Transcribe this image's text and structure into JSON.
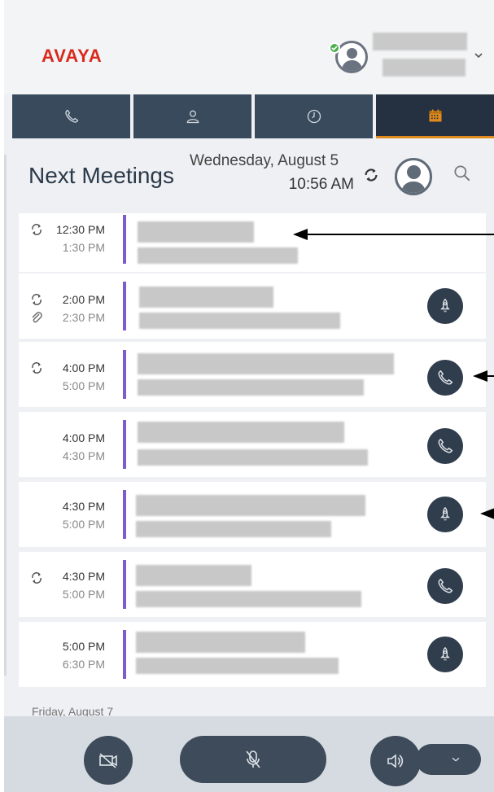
{
  "header": {
    "logo": "AVAYA",
    "icons": {
      "presence": "available-check-icon",
      "avatar": "user-avatar-icon",
      "menu": "chevron-down-icon"
    }
  },
  "tabs": [
    {
      "name": "calls",
      "icon": "phone-icon",
      "active": false
    },
    {
      "name": "contacts",
      "icon": "person-icon",
      "active": false
    },
    {
      "name": "history",
      "icon": "clock-icon",
      "active": false
    },
    {
      "name": "calendar",
      "icon": "calendar-icon",
      "active": true
    }
  ],
  "main": {
    "title": "Next Meetings",
    "date": "Wednesday, August 5",
    "time": "10:56 AM"
  },
  "meetings": [
    {
      "start": "12:30 PM",
      "end": "1:30 PM",
      "recurring": true,
      "attachment": false,
      "action": "none"
    },
    {
      "start": "2:00 PM",
      "end": "2:30 PM",
      "recurring": true,
      "attachment": true,
      "action": "rocket-icon"
    },
    {
      "start": "4:00 PM",
      "end": "5:00 PM",
      "recurring": true,
      "attachment": false,
      "action": "phone-icon"
    },
    {
      "start": "4:00 PM",
      "end": "4:30 PM",
      "recurring": false,
      "attachment": false,
      "action": "phone-icon"
    },
    {
      "start": "4:30 PM",
      "end": "5:00 PM",
      "recurring": false,
      "attachment": false,
      "action": "rocket-icon"
    },
    {
      "start": "4:30 PM",
      "end": "5:00 PM",
      "recurring": true,
      "attachment": false,
      "action": "phone-icon"
    },
    {
      "start": "5:00 PM",
      "end": "6:30 PM",
      "recurring": false,
      "attachment": false,
      "action": "rocket-icon"
    }
  ],
  "next_day": "Friday, August 7",
  "controls": {
    "video": "video-off-icon",
    "mute": "mic-off-icon",
    "speaker": "speaker-icon",
    "dropdown": "chevron-down-icon"
  },
  "colors": {
    "brand": "#da291c",
    "tab_bg": "#394a5c",
    "tab_active": "#253140",
    "tab_accent": "#e08a1e",
    "meeting_bar": "#7b5cc8",
    "presence": "#4caf50"
  }
}
